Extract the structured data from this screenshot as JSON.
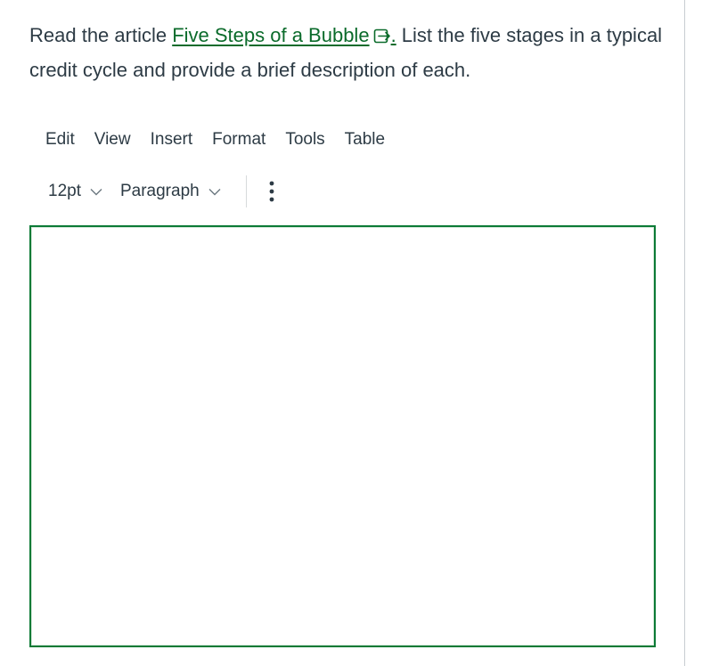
{
  "question": {
    "prefix": "Read the article ",
    "link_text": "Five Steps of a Bubble",
    "link_suffix": ".",
    "suffix": " List the five stages in a typical credit cycle and provide a brief description of each."
  },
  "menubar": {
    "items": [
      "Edit",
      "View",
      "Insert",
      "Format",
      "Tools",
      "Table"
    ]
  },
  "toolbar": {
    "font_size": "12pt",
    "block_format": "Paragraph"
  },
  "editor": {
    "content": ""
  },
  "colors": {
    "link": "#0b6b2b",
    "editor_border": "#0b7a36",
    "text": "#2d3b45"
  },
  "icons": {
    "external_link": "external-link-icon",
    "chevron": "chevron-down-icon",
    "more": "more-vertical-icon"
  }
}
